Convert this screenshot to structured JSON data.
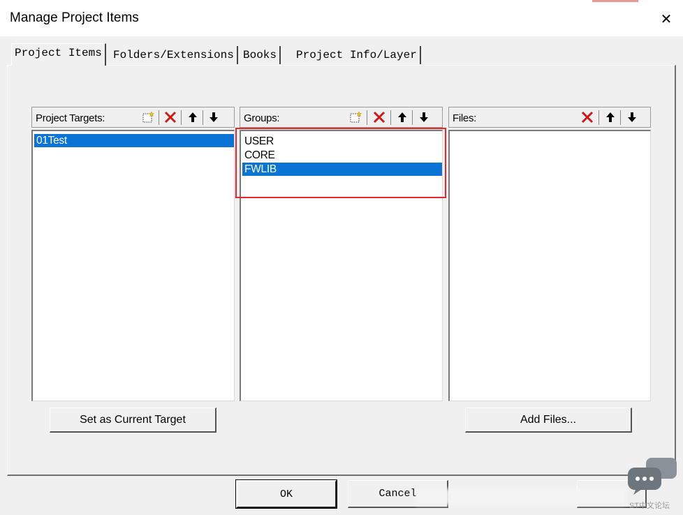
{
  "window": {
    "title": "Manage Project Items",
    "close_glyph": "✕"
  },
  "tabs": [
    {
      "label": "Project Items",
      "active": true
    },
    {
      "label": "Folders/Extensions",
      "active": false
    },
    {
      "label": "Books",
      "active": false
    },
    {
      "label": "Project Info/Layer",
      "active": false
    }
  ],
  "panels": {
    "targets": {
      "label": "Project Targets:",
      "toolbar": [
        "new-icon",
        "delete-icon",
        "move-up-icon",
        "move-down-icon"
      ],
      "items": [
        {
          "text": "01Test",
          "selected": true
        }
      ],
      "button": "Set as Current Target"
    },
    "groups": {
      "label": "Groups:",
      "toolbar": [
        "new-icon",
        "delete-icon",
        "move-up-icon",
        "move-down-icon"
      ],
      "items": [
        {
          "text": "USER",
          "selected": false
        },
        {
          "text": "CORE",
          "selected": false
        },
        {
          "text": "FWLIB",
          "selected": true
        }
      ]
    },
    "files": {
      "label": "Files:",
      "toolbar": [
        "delete-icon",
        "move-up-icon",
        "move-down-icon"
      ],
      "items": [],
      "button": "Add Files..."
    }
  },
  "footer": {
    "ok": "OK",
    "cancel": "Cancel"
  },
  "watermark": {
    "text": "ST中文论坛",
    "icon": "chat-bubble-icon"
  },
  "colors": {
    "selection": "#0a74d6",
    "highlight_box": "#e8272c",
    "delete_x": "#d01818"
  }
}
